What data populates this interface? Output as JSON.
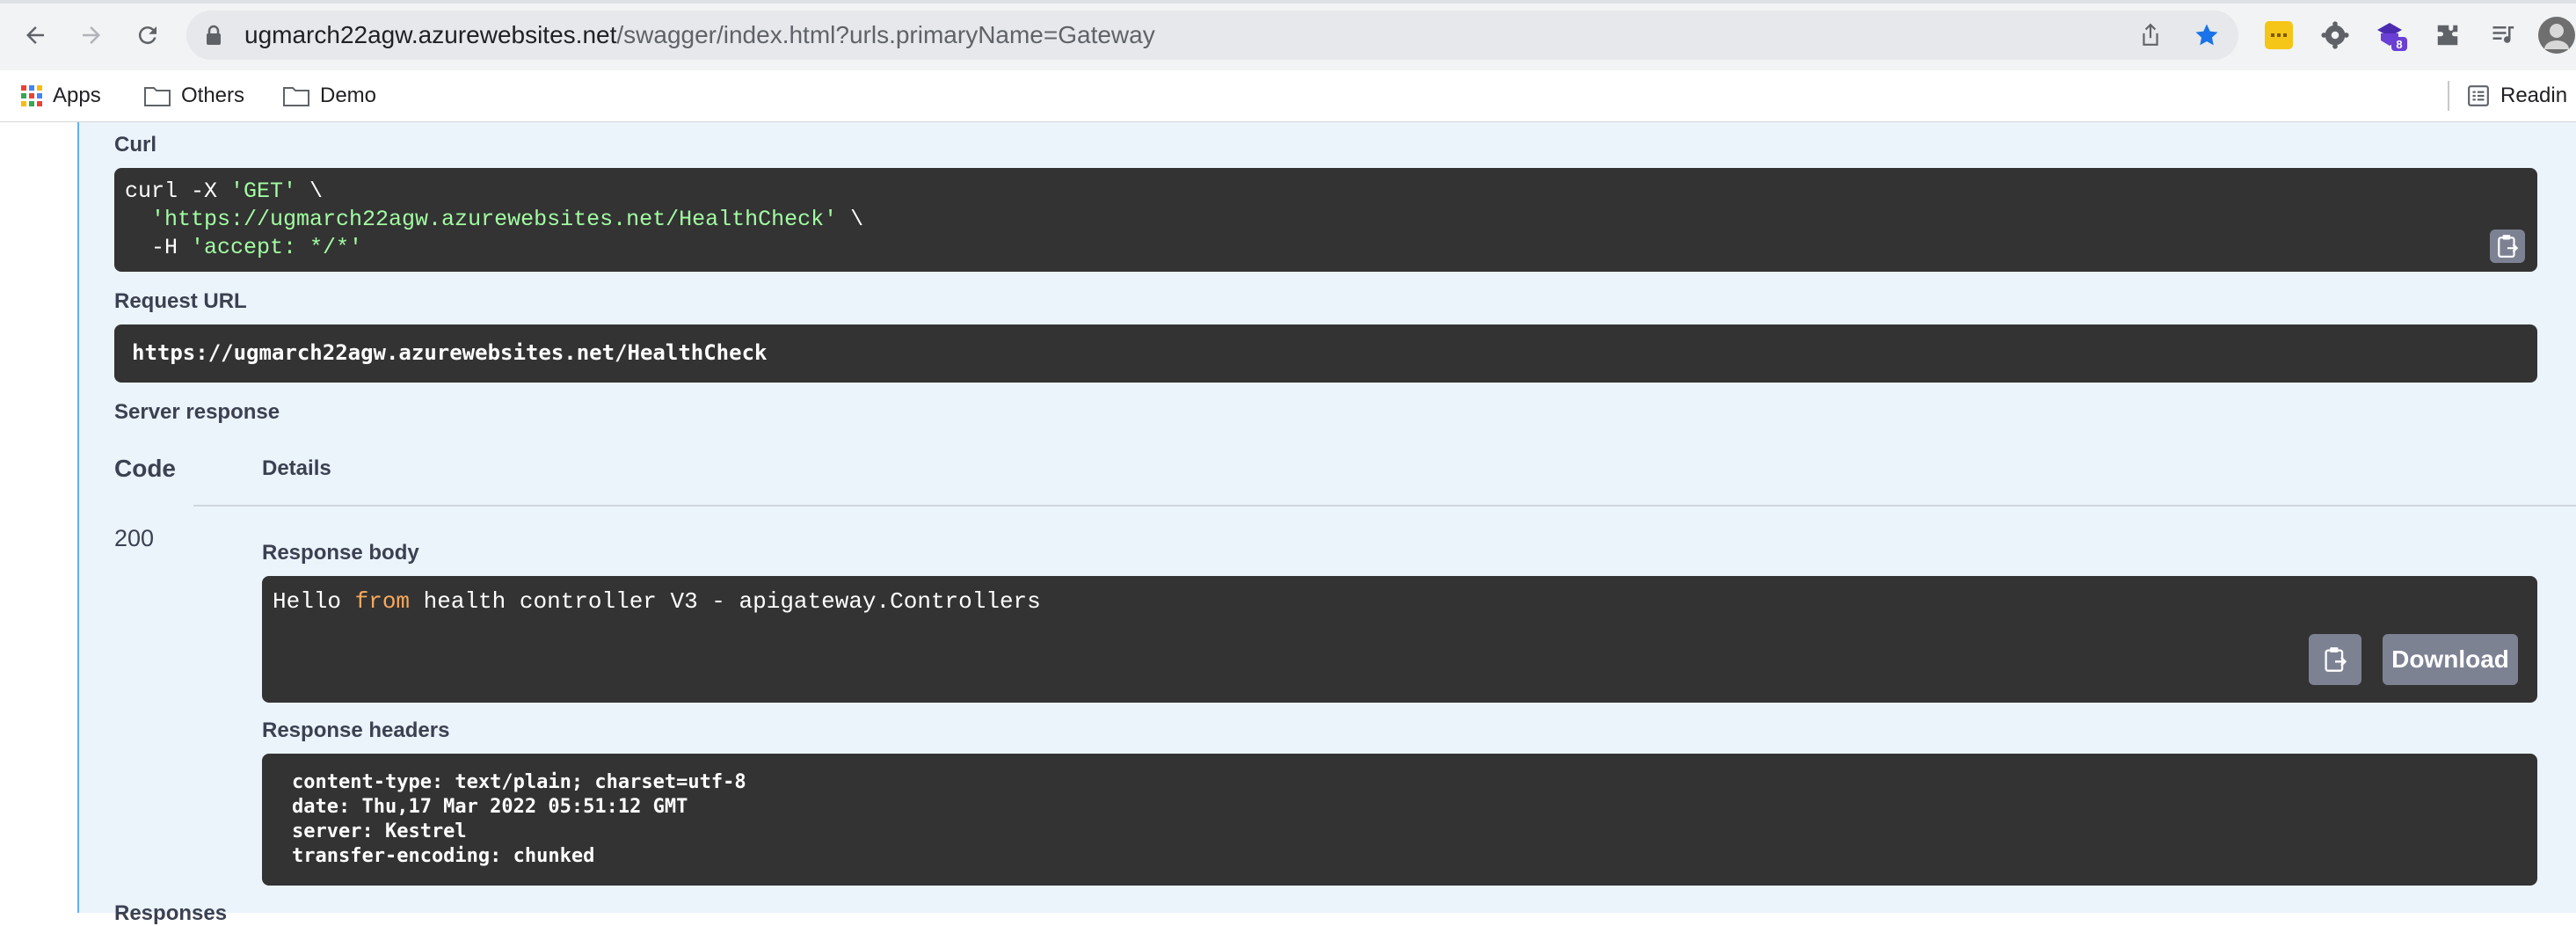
{
  "browser": {
    "url_host": "ugmarch22agw.azurewebsites.net",
    "url_path": "/swagger/index.html?urls.primaryName=Gateway",
    "extension_badge": "8",
    "bookmarks": [
      "Apps",
      "Others",
      "Demo"
    ],
    "reading_list": "Readin"
  },
  "curl": {
    "label": "Curl",
    "line1_cmd": "curl -X ",
    "line1_str": "'GET'",
    "line1_tail": " \\",
    "line2_str": "  'https://ugmarch22agw.azurewebsites.net/HealthCheck'",
    "line2_tail": " \\",
    "line3_cmd": "  -H ",
    "line3_str": "'accept: */*'"
  },
  "request_url": {
    "label": "Request URL",
    "value": "https://ugmarch22agw.azurewebsites.net/HealthCheck"
  },
  "server_response": {
    "label": "Server response",
    "col_code": "Code",
    "col_details": "Details",
    "code": "200",
    "body_label": "Response body",
    "body_pre": "Hello ",
    "body_kw": "from",
    "body_post": " health controller V3 - apigateway.Controllers",
    "download_label": "Download",
    "headers_label": "Response headers",
    "headers": [
      "content-type: text/plain; charset=utf-8",
      "date: Thu,17 Mar 2022 05:51:12 GMT",
      "server: Kestrel",
      "transfer-encoding: chunked"
    ],
    "next_section_partial": "Responses"
  }
}
